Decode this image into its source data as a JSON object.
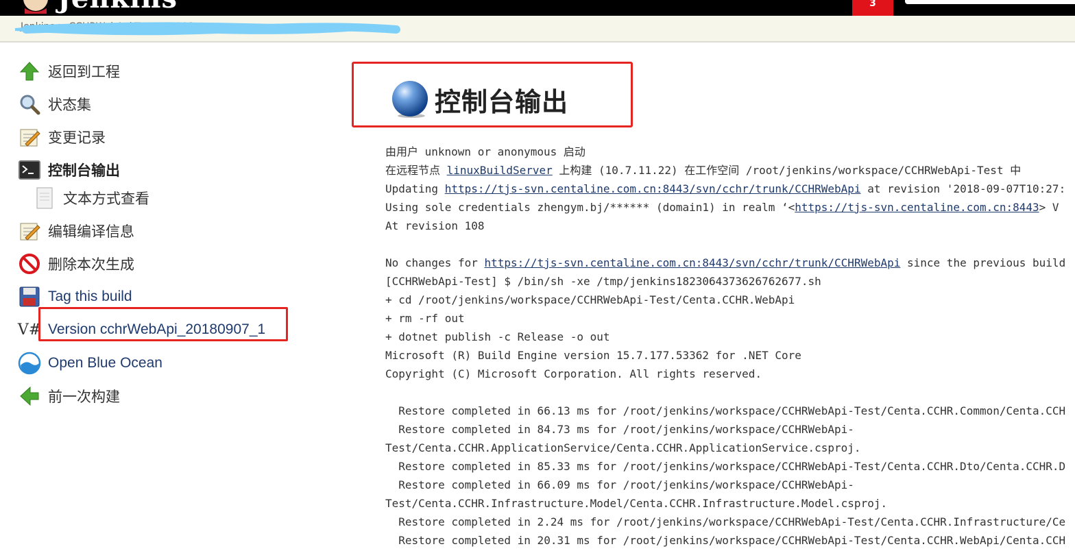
{
  "header": {
    "logo_text": "Jenkins",
    "alert_count": "3"
  },
  "breadcrumb": {
    "text": "Jenkins > CCHRWebApi-Test > #108"
  },
  "side_panel": {
    "items": [
      {
        "label": "返回到工程",
        "icon": "up-arrow-icon"
      },
      {
        "label": "状态集",
        "icon": "search-icon"
      },
      {
        "label": "变更记录",
        "icon": "notepad-icon"
      },
      {
        "label": "控制台输出",
        "icon": "terminal-icon"
      },
      {
        "label": "文本方式查看",
        "icon": "document-icon"
      },
      {
        "label": "编辑编译信息",
        "icon": "notepad-icon"
      },
      {
        "label": "删除本次生成",
        "icon": "no-entry-icon"
      },
      {
        "label": "Tag this build",
        "icon": "floppy-disk-icon"
      },
      {
        "label": "Version cchrWebApi_20180907_1",
        "icon": "version-icon"
      },
      {
        "label": "Open Blue Ocean",
        "icon": "blue-ocean-icon"
      },
      {
        "label": "前一次构建",
        "icon": "left-arrow-icon"
      }
    ],
    "version_icon_text": "V#"
  },
  "main": {
    "title": "控制台输出"
  },
  "console": {
    "l1": "由用户 unknown or anonymous 启动",
    "l2_pre": "在远程节点 ",
    "l2_link": "linuxBuildServer",
    "l2_post": " 上构建 (10.7.11.22) 在工作空间 /root/jenkins/workspace/CCHRWebApi-Test 中",
    "l3_pre": "Updating ",
    "l3_link": "https://tjs-svn.centaline.com.cn:8443/svn/cchr/trunk/CCHRWebApi",
    "l3_post": " at revision '2018-09-07T10:27:",
    "l4_pre": "Using sole credentials zhengym.bj/****** (domain1) in realm ‘<",
    "l4_link": "https://tjs-svn.centaline.com.cn:8443",
    "l4_post": "> V",
    "l5": "At revision 108",
    "l6": "",
    "l7_pre": "No changes for ",
    "l7_link": "https://tjs-svn.centaline.com.cn:8443/svn/cchr/trunk/CCHRWebApi",
    "l7_post": " since the previous build",
    "l8": "[CCHRWebApi-Test] $ /bin/sh -xe /tmp/jenkins1823064373626762677.sh",
    "l9": "+ cd /root/jenkins/workspace/CCHRWebApi-Test/Centa.CCHR.WebApi",
    "l10": "+ rm -rf out",
    "l11": "+ dotnet publish -c Release -o out",
    "l12": "Microsoft (R) Build Engine version 15.7.177.53362 for .NET Core",
    "l13": "Copyright (C) Microsoft Corporation. All rights reserved.",
    "l14": "",
    "l15": "  Restore completed in 66.13 ms for /root/jenkins/workspace/CCHRWebApi-Test/Centa.CCHR.Common/Centa.CCH",
    "l16": "  Restore completed in 84.73 ms for /root/jenkins/workspace/CCHRWebApi-",
    "l17": "Test/Centa.CCHR.ApplicationService/Centa.CCHR.ApplicationService.csproj.",
    "l18": "  Restore completed in 85.33 ms for /root/jenkins/workspace/CCHRWebApi-Test/Centa.CCHR.Dto/Centa.CCHR.D",
    "l19": "  Restore completed in 66.09 ms for /root/jenkins/workspace/CCHRWebApi-",
    "l20": "Test/Centa.CCHR.Infrastructure.Model/Centa.CCHR.Infrastructure.Model.csproj.",
    "l21": "  Restore completed in 2.24 ms for /root/jenkins/workspace/CCHRWebApi-Test/Centa.CCHR.Infrastructure/Ce",
    "l22": "  Restore completed in 20.31 ms for /root/jenkins/workspace/CCHRWebApi-Test/Centa.CCHR.WebApi/Centa.CCH"
  },
  "colors": {
    "header_bg": "#000000",
    "alert_badge": "#e0131a",
    "highlight_box": "#e52521",
    "link": "#1f3a6d",
    "redaction": "#7fd0f8"
  }
}
